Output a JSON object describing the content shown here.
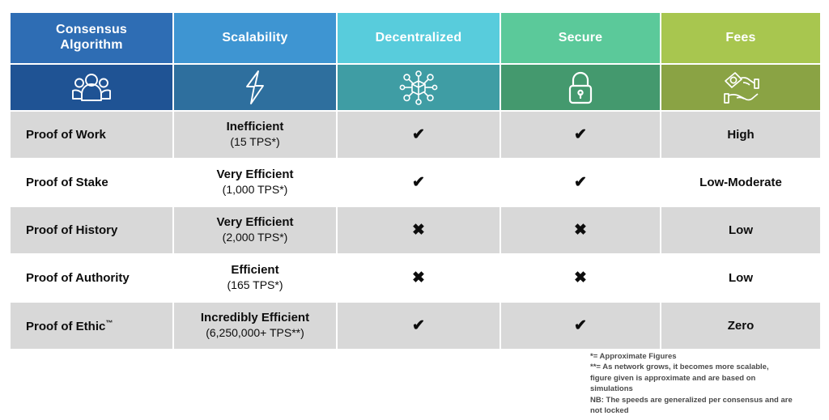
{
  "table": {
    "columns": [
      {
        "key": "algorithm",
        "label": "Consensus\nAlgorithm",
        "icon": "people-group-icon",
        "color_top": "#2E6DB4",
        "color_bottom": "#1F5394"
      },
      {
        "key": "scalability",
        "label": "Scalability",
        "icon": "lightning-bolt-icon",
        "color_top": "#3E95D2",
        "color_bottom": "#2E6F9E"
      },
      {
        "key": "decentralized",
        "label": "Decentralized",
        "icon": "network-node-icon",
        "color_top": "#58CCDC",
        "color_bottom": "#3F9DA4"
      },
      {
        "key": "secure",
        "label": "Secure",
        "icon": "padlock-icon",
        "color_top": "#5BC99A",
        "color_bottom": "#44996E"
      },
      {
        "key": "fees",
        "label": "Fees",
        "icon": "hand-money-icon",
        "color_top": "#A8C64F",
        "color_bottom": "#8AA344"
      }
    ],
    "rows": [
      {
        "algorithm": "Proof of Work",
        "scalability_main": "Inefficient",
        "scalability_sub": "(15 TPS*)",
        "decentralized": "✔",
        "decentralized_value": "yes",
        "secure": "✔",
        "secure_value": "yes",
        "fees": "High",
        "shaded": true
      },
      {
        "algorithm": "Proof of Stake",
        "scalability_main": "Very Efficient",
        "scalability_sub": "(1,000 TPS*)",
        "decentralized": "✔",
        "decentralized_value": "yes",
        "secure": "✔",
        "secure_value": "yes",
        "fees": "Low-Moderate",
        "shaded": false
      },
      {
        "algorithm": "Proof of History",
        "scalability_main": "Very Efficient",
        "scalability_sub": "(2,000 TPS*)",
        "decentralized": "✖",
        "decentralized_value": "no",
        "secure": "✖",
        "secure_value": "no",
        "fees": "Low",
        "shaded": true
      },
      {
        "algorithm": "Proof of Authority",
        "scalability_main": "Efficient",
        "scalability_sub": "(165 TPS*)",
        "decentralized": "✖",
        "decentralized_value": "no",
        "secure": "✖",
        "secure_value": "no",
        "fees": "Low",
        "shaded": false
      },
      {
        "algorithm": "Proof of Ethic",
        "algorithm_suffix": "™",
        "scalability_main": "Incredibly Efficient",
        "scalability_sub": "(6,250,000+ TPS**)",
        "decentralized": "✔",
        "decentralized_value": "yes",
        "secure": "✔",
        "secure_value": "yes",
        "fees": "Zero",
        "shaded": true
      }
    ]
  },
  "footnote": {
    "line1": "*= Approximate Figures",
    "line2": "**= As network grows, it becomes more scalable,",
    "line3": "figure given is approximate and are based on",
    "line4": "simulations",
    "line5": "NB: The speeds are generalized per consensus and are",
    "line6": "not locked"
  },
  "colors": {
    "row_shaded": "#d8d8d8",
    "row_plain": "#ffffff",
    "text": "#0d0d0d",
    "footnote_text": "#4a4a4a",
    "page_background": "#ffffff"
  }
}
